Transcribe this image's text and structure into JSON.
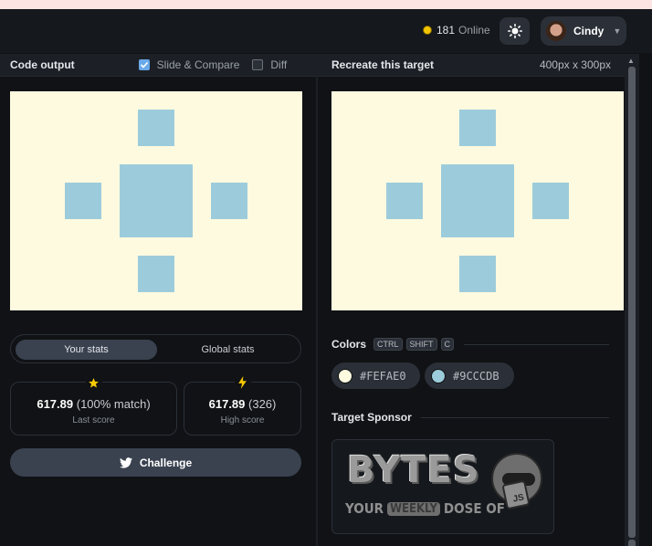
{
  "header": {
    "online_count": "181",
    "online_label": "Online",
    "user_name": "Cindy"
  },
  "left_panel": {
    "title": "Code output",
    "slide_compare_label": "Slide & Compare",
    "slide_compare_checked": true,
    "diff_label": "Diff",
    "diff_checked": false
  },
  "right_panel": {
    "title": "Recreate this target",
    "dimensions": "400px x 300px"
  },
  "target_colors": {
    "background": "#FEFAE0",
    "shape": "#9CCCDB"
  },
  "stats": {
    "tabs": [
      "Your stats",
      "Global stats"
    ],
    "active_tab": "Your stats",
    "last_score_value": "617.89",
    "last_score_detail": "(100% match)",
    "last_score_label": "Last score",
    "high_score_value": "617.89",
    "high_score_detail": "(326)",
    "high_score_label": "High score",
    "challenge_label": "Challenge"
  },
  "colors_section": {
    "title": "Colors",
    "shortcut_keys": [
      "CTRL",
      "SHIFT",
      "C"
    ],
    "swatches": [
      {
        "hex": "#FEFAE0",
        "label": "#FEFAE0"
      },
      {
        "hex": "#9CCCDB",
        "label": "#9CCCDB"
      }
    ]
  },
  "sponsor_section": {
    "title": "Target Sponsor",
    "logo_text": "BYTES",
    "tagline_pre": "YOUR",
    "tagline_highlight": "WEEKLY",
    "tagline_post": "DOSE OF",
    "badge_text": "JS"
  }
}
